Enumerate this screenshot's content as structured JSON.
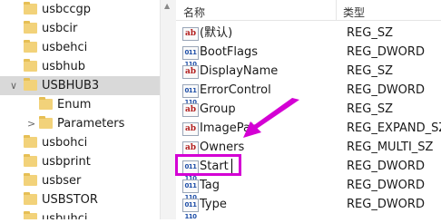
{
  "tree": {
    "items": [
      {
        "label": "usbccgp",
        "chevron": ""
      },
      {
        "label": "usbcir",
        "chevron": ""
      },
      {
        "label": "usbehci",
        "chevron": ""
      },
      {
        "label": "usbhub",
        "chevron": ""
      },
      {
        "label": "USBHUB3",
        "chevron": "∨"
      },
      {
        "label": "Enum",
        "chevron": ""
      },
      {
        "label": "Parameters",
        "chevron": ">"
      },
      {
        "label": "usbohci",
        "chevron": ""
      },
      {
        "label": "usbprint",
        "chevron": ""
      },
      {
        "label": "usbser",
        "chevron": ""
      },
      {
        "label": "USBSTOR",
        "chevron": ""
      },
      {
        "label": "usbuhci",
        "chevron": ""
      }
    ]
  },
  "values": {
    "col_name": "名称",
    "col_type": "类型",
    "rows": [
      {
        "icon": "ab",
        "name": "(默认)",
        "type": "REG_SZ"
      },
      {
        "icon": "dword",
        "name": "BootFlags",
        "type": "REG_DWORD"
      },
      {
        "icon": "ab",
        "name": "DisplayName",
        "type": "REG_SZ"
      },
      {
        "icon": "dword",
        "name": "ErrorControl",
        "type": "REG_DWORD"
      },
      {
        "icon": "ab",
        "name": "Group",
        "type": "REG_SZ"
      },
      {
        "icon": "ab",
        "name": "ImagePat",
        "type": "REG_EXPAND_SZ"
      },
      {
        "icon": "ab",
        "name": "Owners",
        "type": "REG_MULTI_SZ"
      },
      {
        "icon": "dword",
        "name": "Start",
        "type": "REG_DWORD"
      },
      {
        "icon": "dword",
        "name": "Tag",
        "type": "REG_DWORD"
      },
      {
        "icon": "dword",
        "name": "Type",
        "type": "REG_DWORD"
      }
    ]
  },
  "icon_text": {
    "ab": "ab",
    "dword": "011 110"
  },
  "colors": {
    "highlight": "#d400d4",
    "arrow": "#d400d4",
    "folder": "#f2d27a"
  }
}
